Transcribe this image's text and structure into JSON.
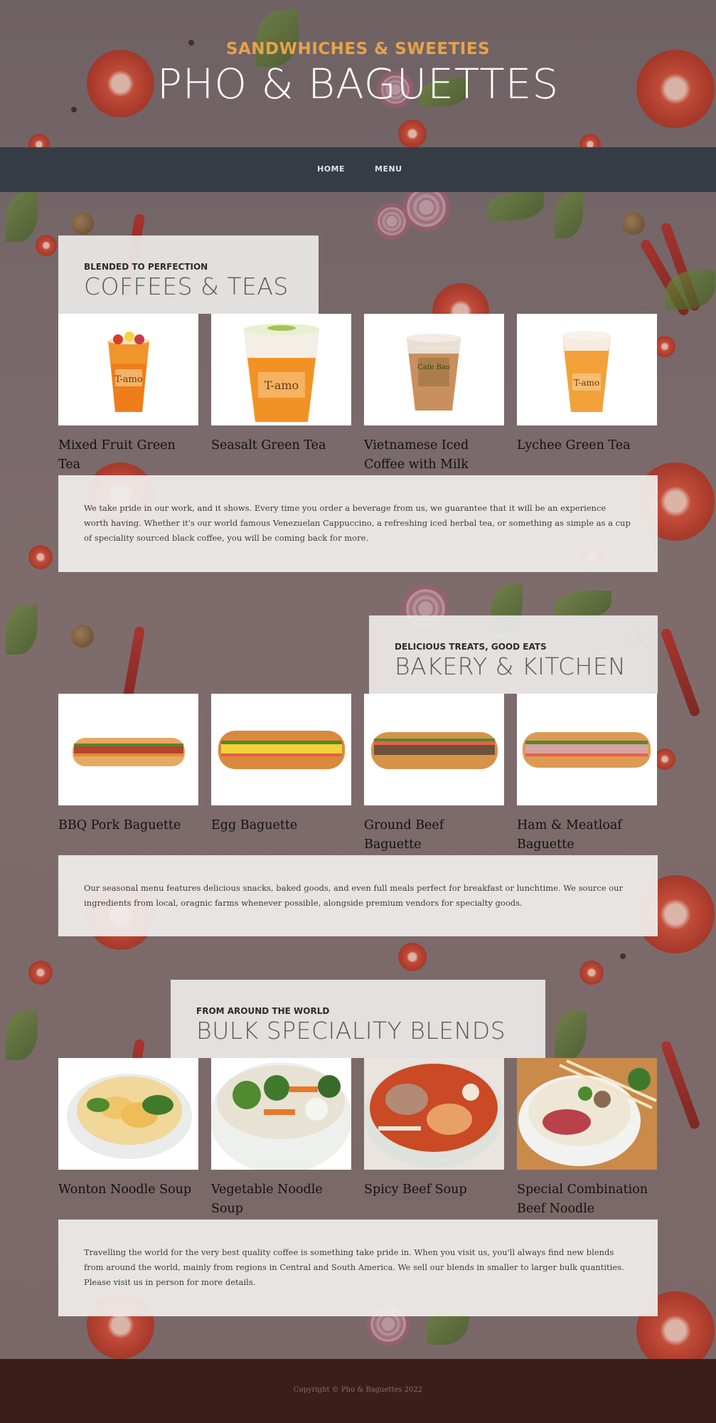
{
  "header": {
    "subtitle": "SANDWHICHES & SWEETIES",
    "title": "PHO & BAGUETTES"
  },
  "nav": {
    "items": [
      {
        "label": "HOME"
      },
      {
        "label": "MENU"
      }
    ]
  },
  "sections": [
    {
      "small": "BLENDED TO PERFECTION",
      "large": "COFFEES & TEAS",
      "items": [
        {
          "name": "Mixed Fruit Green Tea"
        },
        {
          "name": "Seasalt Green Tea"
        },
        {
          "name": "Vietnamese Iced Coffee with Milk"
        },
        {
          "name": "Lychee Green Tea"
        }
      ],
      "description": "We take pride in our work, and it shows. Every time you order a beverage from us, we guarantee that it will be an experience worth having. Whether it's our world famous Venezuelan Cappuccino, a refreshing iced herbal tea, or something as simple as a cup of speciality sourced black coffee, you will be coming back for more."
    },
    {
      "small": "DELICIOUS TREATS, GOOD EATS",
      "large": "BAKERY & KITCHEN",
      "items": [
        {
          "name": "BBQ Pork Baguette"
        },
        {
          "name": "Egg Baguette"
        },
        {
          "name": "Ground Beef Baguette"
        },
        {
          "name": "Ham & Meatloaf Baguette"
        }
      ],
      "description": "Our seasonal menu features delicious snacks, baked goods, and even full meals perfect for breakfast or lunchtime. We source our ingredients from local, oragnic farms whenever possible, alongside premium vendors for specialty goods."
    },
    {
      "small": "FROM AROUND THE WORLD",
      "large": "BULK SPECIALITY BLENDS",
      "items": [
        {
          "name": "Wonton Noodle Soup"
        },
        {
          "name": "Vegetable Noodle Soup"
        },
        {
          "name": "Spicy Beef Soup"
        },
        {
          "name": "Special Combination Beef Noodle"
        }
      ],
      "description": "Travelling the world for the very best quality coffee is something take pride in. When you visit us, you'll always find new blends from around the world, mainly from regions in Central and South America. We sell our blends in smaller to larger bulk quantities. Please visit us in person for more details."
    }
  ],
  "footer": {
    "copyright": "Copyright © Pho & Baguettes 2022"
  },
  "colors": {
    "accent": "#e6a24d",
    "navbar": "#363c45",
    "footer": "#3a1e17"
  },
  "drink_labels": [
    "T-amo",
    "T-amo",
    "Cafe Bao",
    "T-amo"
  ]
}
